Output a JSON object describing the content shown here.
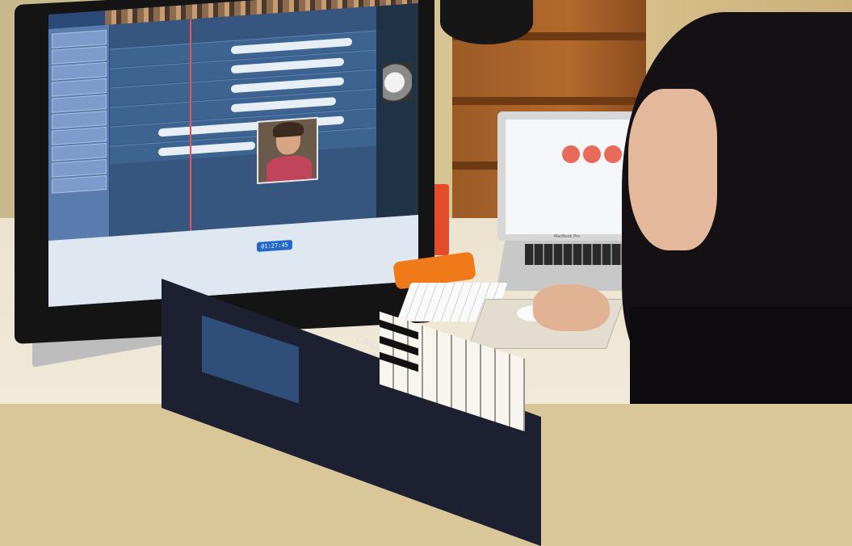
{
  "scene": {
    "laptop_brand": "MacBook Pro",
    "synth_brand": "CASIO",
    "timecode": "01:27:45",
    "icons": [
      "imac-monitor",
      "laptop",
      "synthesizer-keyboard",
      "computer-mouse",
      "external-drive"
    ]
  },
  "palette": {
    "wall": "#d6c597",
    "shelf": "#b36a2c",
    "editor_blue": "#36557f",
    "playhead_red": "#ff4a4a",
    "drive_orange": "#f07a1a"
  }
}
